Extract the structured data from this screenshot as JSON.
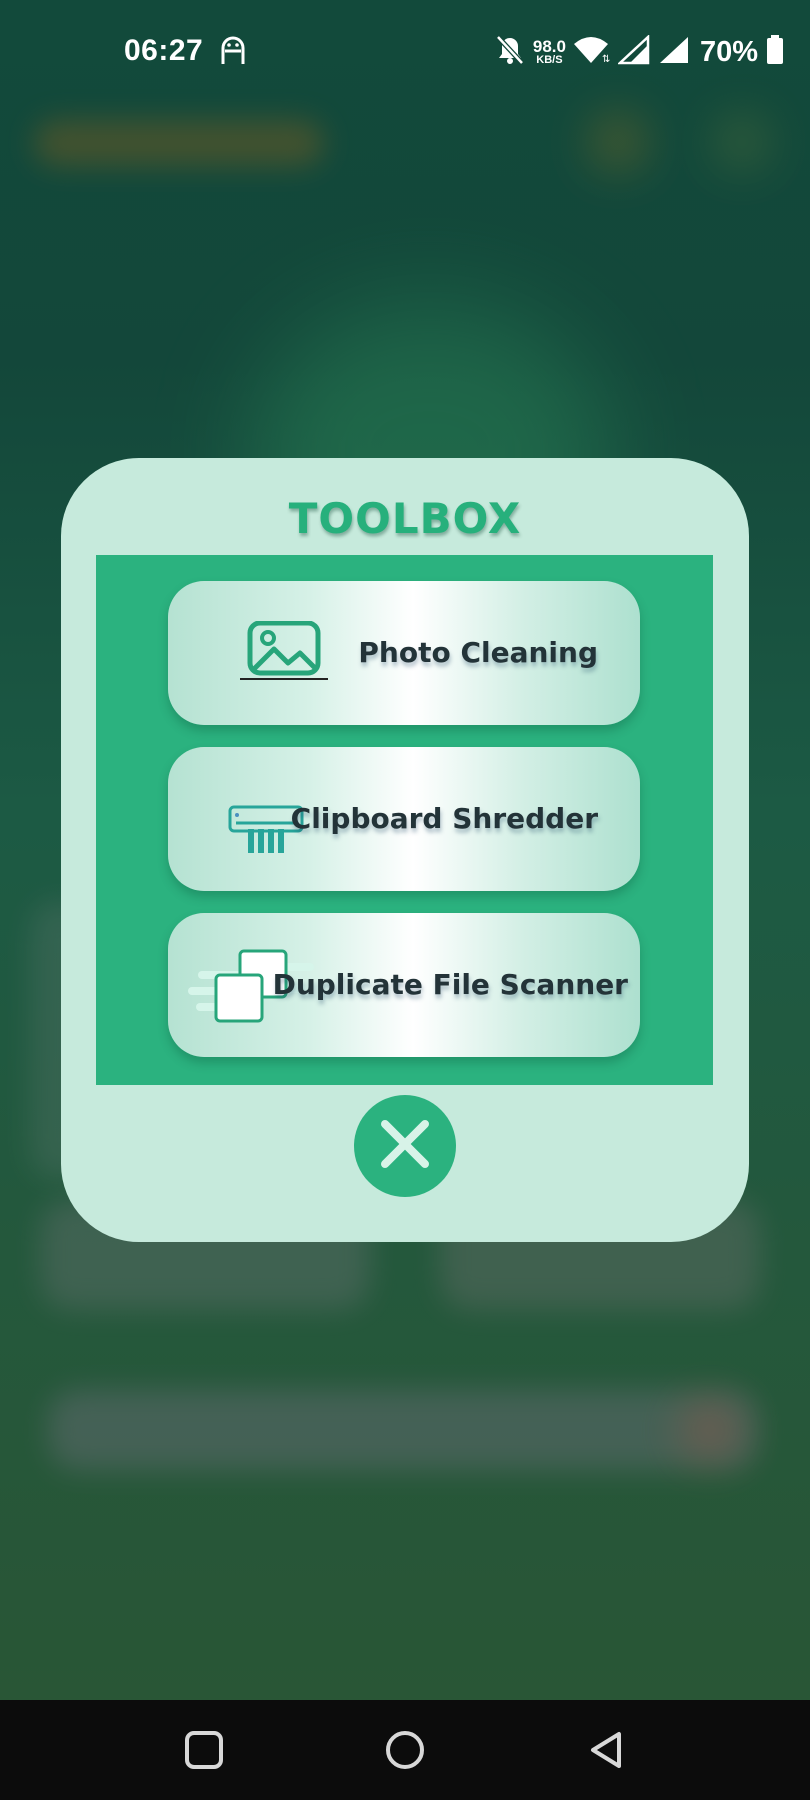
{
  "status_bar": {
    "time": "06:27",
    "net_speed_value": "98.0",
    "net_speed_unit": "KB/S",
    "battery_percent": "70%",
    "icons": [
      "ghost-icon",
      "bell-off-icon",
      "wifi-icon",
      "signal-icon",
      "signal-icon",
      "battery-icon"
    ]
  },
  "toolbox": {
    "title": "TOOLBOX",
    "items": [
      {
        "label": "Photo Cleaning",
        "icon": "photo-icon"
      },
      {
        "label": "Clipboard Shredder",
        "icon": "shredder-icon"
      },
      {
        "label": "Duplicate File Scanner",
        "icon": "duplicate-files-icon"
      }
    ],
    "close_icon": "close-icon"
  },
  "colors": {
    "accent": "#2bb27f",
    "dialog_bg": "#c6eadc",
    "label_text": "#233338",
    "scrim": "#124a3b"
  },
  "nav_bar": {
    "buttons": [
      "recents-square-icon",
      "home-circle-icon",
      "back-triangle-icon"
    ]
  }
}
